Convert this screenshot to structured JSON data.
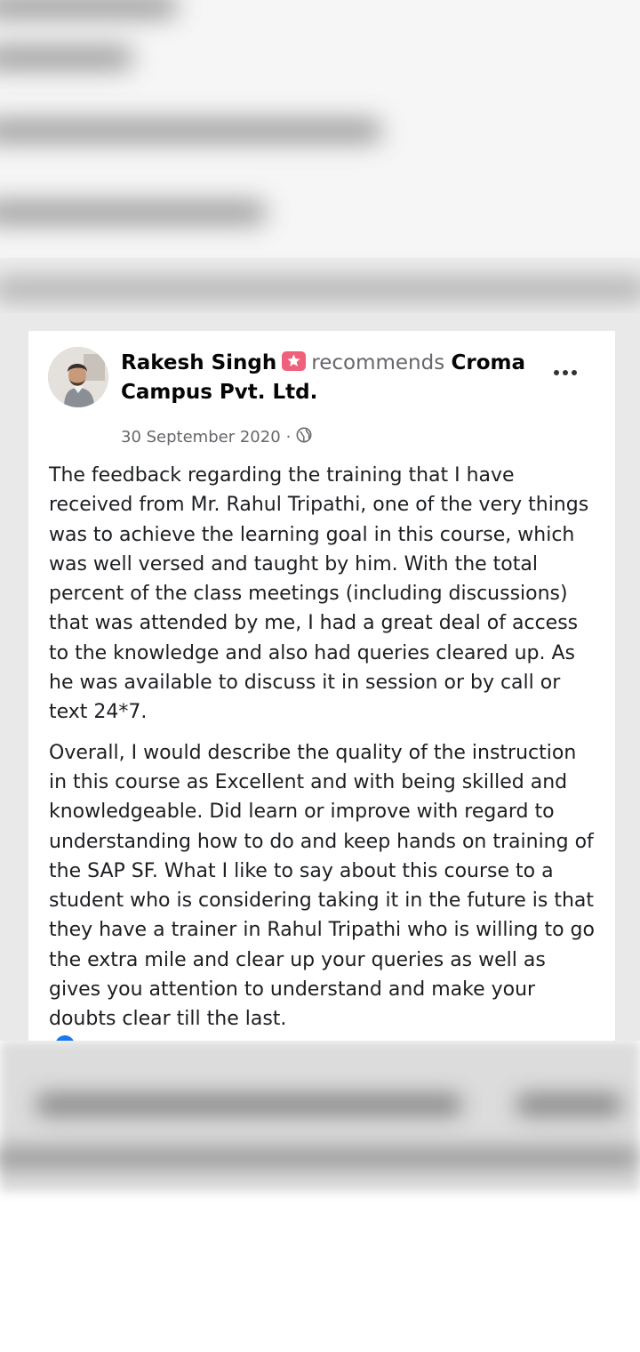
{
  "post": {
    "author": "Rakesh Singh",
    "recommends": "recommends",
    "page_name": "Croma Campus Pvt. Ltd.",
    "date": "30 September 2020",
    "separator": "·",
    "audience_icon": "globe-icon",
    "badge_icon": "star-badge-icon",
    "more_icon": "more-options-icon",
    "paragraphs": [
      "The feedback regarding the training that I have received from Mr. Rahul Tripathi, one of the very things was to achieve the learning goal in this course, which was well versed and taught by him. With the total percent of the class meetings (including discussions) that was attended by me, I had a great deal of access to the knowledge and also had queries cleared up. As he was available to discuss it in session or by call or text 24*7.",
      "Overall, I would describe the quality of the instruction in this course as Excellent and with being skilled and knowledgeable. Did learn or improve with regard to understanding how to do and keep hands on training of the SAP SF. What I like to say about this course to a student who is considering taking it in the future is that they have a trainer in Rahul Tripathi who is willing to go the extra mile and clear up your queries as well as gives you attention to understand and make your doubts clear till the last."
    ]
  },
  "colors": {
    "badge": "#f0607a",
    "secondary_text": "#65676b",
    "reaction_blue": "#1877f2"
  }
}
